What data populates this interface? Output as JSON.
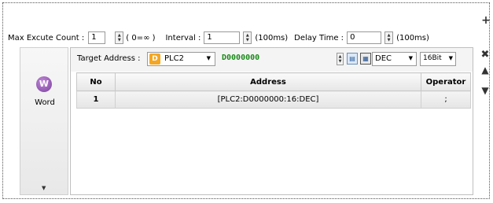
{
  "toolbar": {
    "max_execute_label": "Max Excute Count :",
    "max_execute_value": "1",
    "max_execute_hint": "( 0=∞ )",
    "interval_label": "Interval :",
    "interval_value": "1",
    "interval_unit": "(100ms)",
    "delay_label": "Delay Time :",
    "delay_value": "0",
    "delay_unit": "(100ms)"
  },
  "sidebar": {
    "icon_letter": "W",
    "label": "Word"
  },
  "target": {
    "label": "Target Address :",
    "plc_icon": "D",
    "plc_value": "PLC2",
    "address_value": "D0000000",
    "format_value": "DEC",
    "bit_value": "16Bit"
  },
  "table": {
    "columns": [
      "No",
      "Address",
      "Operator"
    ],
    "rows": [
      {
        "no": "1",
        "address": "[PLC2:D0000000:16:DEC]",
        "operator": ";"
      }
    ]
  },
  "right_toolbar": {
    "add_icon": "plus-icon",
    "up_icon": "up-arrow-icon",
    "delete_icon": "delete-icon",
    "move_up_icon": "move-up-icon",
    "move_down_icon": "move-down-icon"
  }
}
